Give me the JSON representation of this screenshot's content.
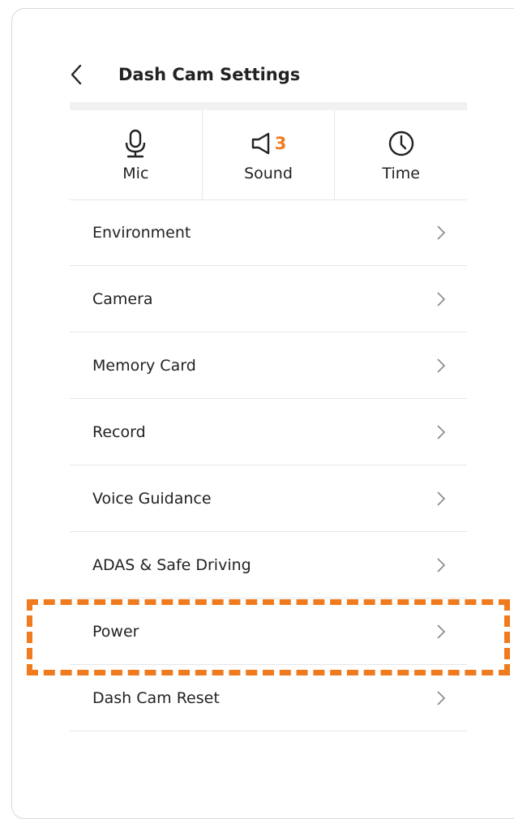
{
  "header": {
    "title": "Dash Cam Settings",
    "back_icon": "chevron-left-icon"
  },
  "quick_settings": [
    {
      "label": "Mic",
      "icon": "microphone-icon"
    },
    {
      "label": "Sound",
      "icon": "speaker-icon",
      "value": "3"
    },
    {
      "label": "Time",
      "icon": "clock-icon"
    }
  ],
  "menu": {
    "items": [
      {
        "label": "Environment"
      },
      {
        "label": "Camera"
      },
      {
        "label": "Memory Card"
      },
      {
        "label": "Record"
      },
      {
        "label": "Voice Guidance"
      },
      {
        "label": "ADAS & Safe Driving"
      },
      {
        "label": "Power"
      },
      {
        "label": "Dash Cam Reset"
      }
    ],
    "chevron_icon": "chevron-right-icon"
  },
  "highlight": {
    "target": "Power",
    "color": "#f07b1f"
  },
  "colors": {
    "accent": "#f07b1f",
    "divider": "#e6e6e6",
    "text": "#222222"
  }
}
